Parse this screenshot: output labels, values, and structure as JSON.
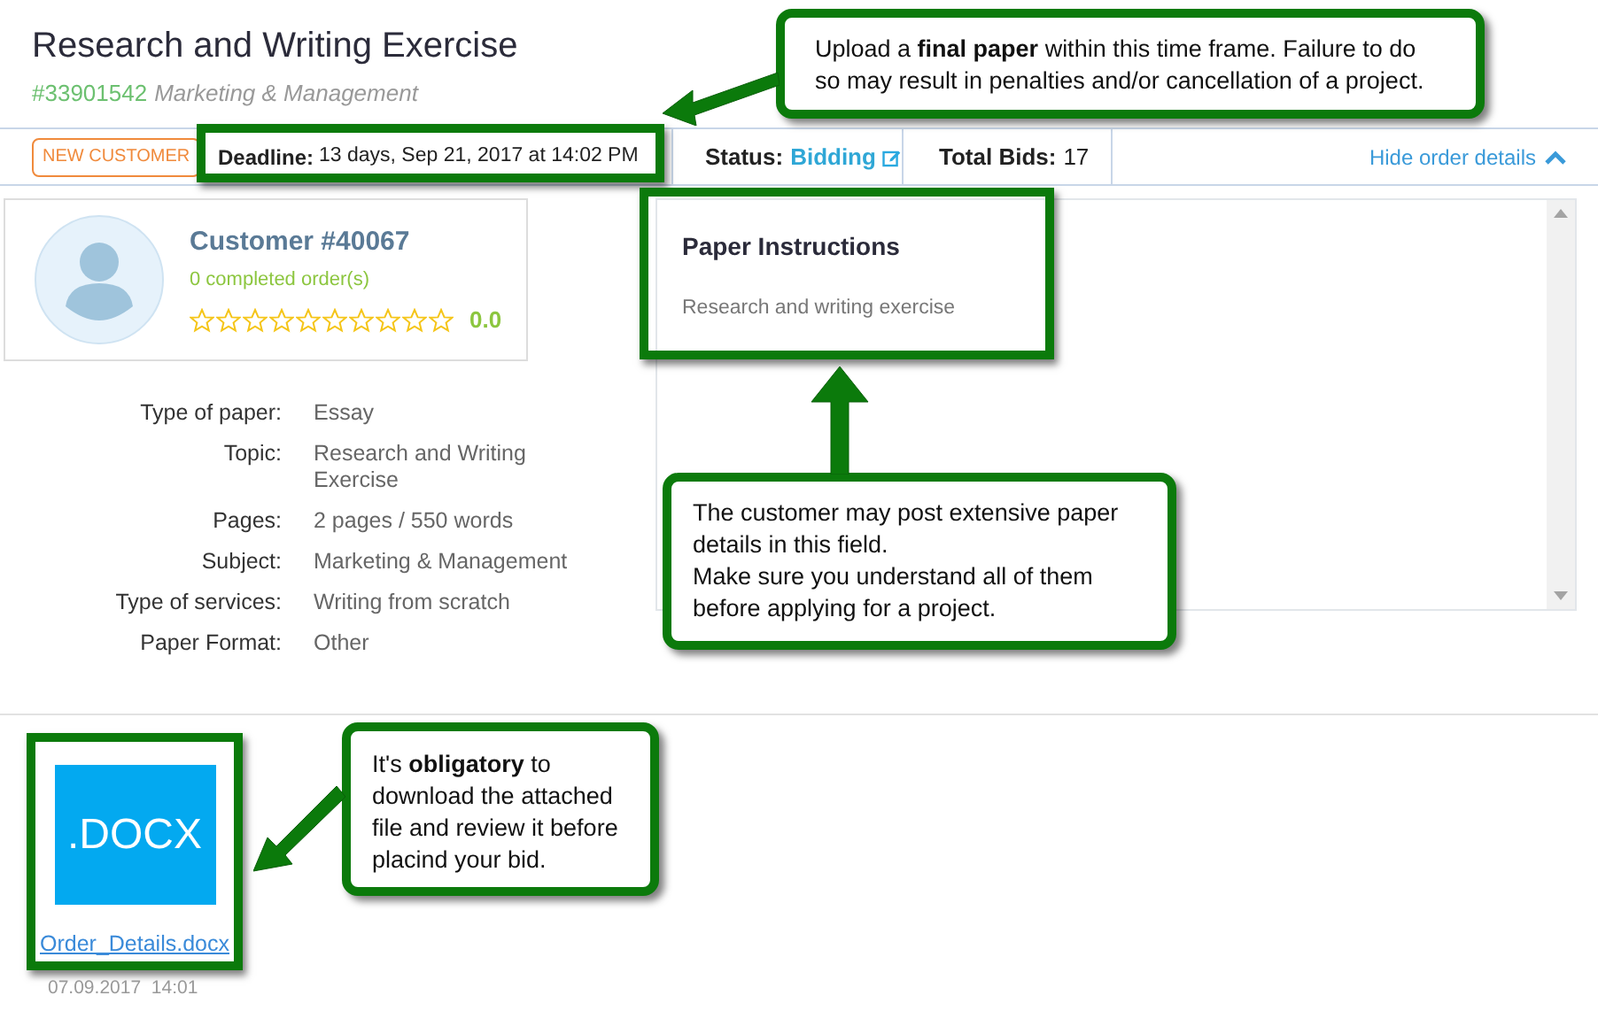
{
  "title": "Research and Writing Exercise",
  "order_number": "#33901542",
  "category": "Marketing & Management",
  "badge": "NEW CUSTOMER",
  "deadline": {
    "label": "Deadline:",
    "value": "13 days, Sep 21, 2017 at 14:02 PM"
  },
  "status": {
    "label": "Status:",
    "value": "Bidding"
  },
  "total_bids": {
    "label": "Total Bids:",
    "value": "17"
  },
  "hide_link": "Hide order details",
  "customer": {
    "name": "Customer #40067",
    "orders": "0 completed order(s)",
    "stars": 0,
    "rating": "0.0"
  },
  "details": [
    {
      "label": "Type of paper:",
      "value": "Essay"
    },
    {
      "label": "Topic:",
      "value": "Research and Writing Exercise"
    },
    {
      "label": "Pages:",
      "value": "2 pages / 550 words"
    },
    {
      "label": "Subject:",
      "value": "Marketing & Management"
    },
    {
      "label": "Type of services:",
      "value": "Writing from scratch"
    },
    {
      "label": "Paper Format:",
      "value": "Other"
    }
  ],
  "instructions": {
    "title": "Paper Instructions",
    "text": "Research and writing exercise"
  },
  "attachment": {
    "tile_label": ".DOCX",
    "filename": "Order_Details.docx",
    "date": "07.09.2017  14:01"
  },
  "callouts": [
    {
      "text": "Upload a **final paper** within this time frame. Failure to do so may result in penalties and/or cancellation of a project."
    },
    {
      "text": "The customer may post extensive paper details in this field.\nMake sure you understand all of them before applying for a project."
    },
    {
      "text": "It's **obligatory** to download the attached file and review it before placind your bid."
    }
  ]
}
